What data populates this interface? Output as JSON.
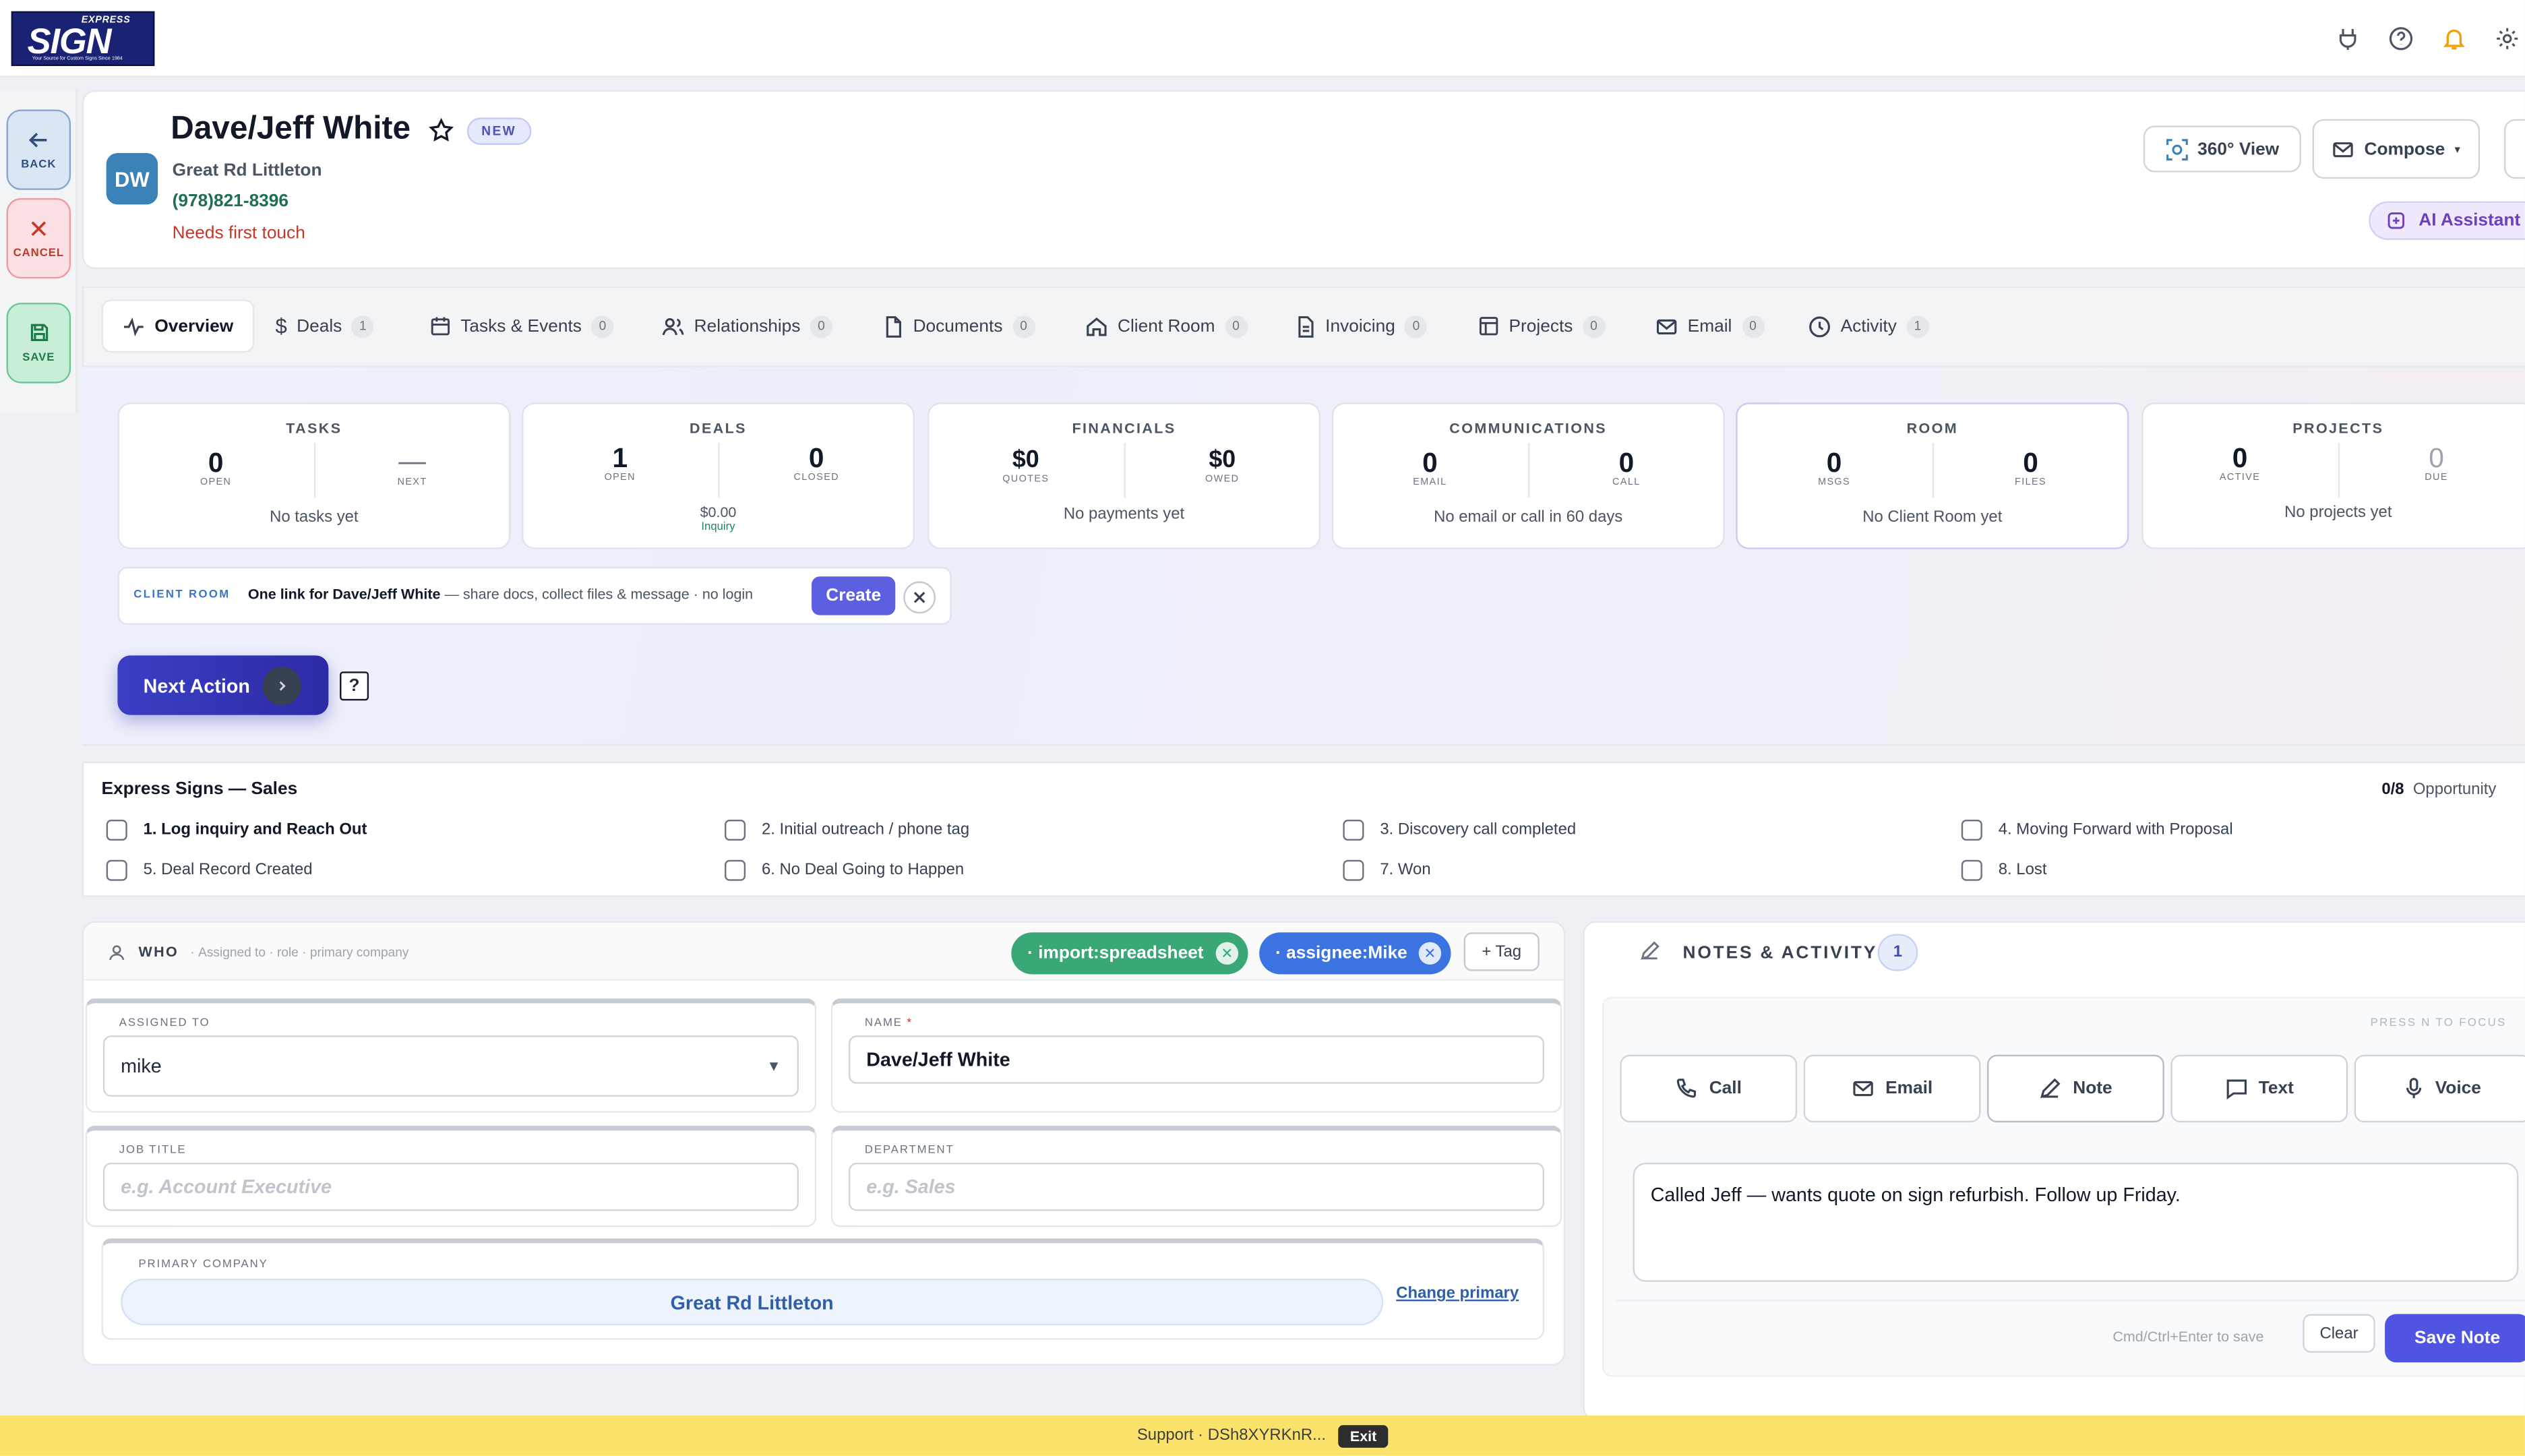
{
  "brand": {
    "logo_text": "SIGN",
    "logo_small": "EXPRESS",
    "logo_tagline": "Your Source for Custom Signs Since 1984"
  },
  "rail": {
    "back": "BACK",
    "cancel": "CANCEL",
    "save": "SAVE"
  },
  "contact": {
    "name": "Dave/Jeff White",
    "badge": "NEW",
    "initials": "DW",
    "address": "Great Rd Littleton",
    "phone": "(978)821-8396",
    "status": "Needs first touch"
  },
  "header_actions": {
    "view360": "360° View",
    "compose": "Compose",
    "ai": "AI Assistant"
  },
  "tabs": [
    {
      "label": "Overview"
    },
    {
      "label": "Deals",
      "count": "1"
    },
    {
      "label": "Tasks & Events",
      "count": "0"
    },
    {
      "label": "Relationships",
      "count": "0"
    },
    {
      "label": "Documents",
      "count": "0"
    },
    {
      "label": "Client Room",
      "count": "0"
    },
    {
      "label": "Invoicing",
      "count": "0"
    },
    {
      "label": "Projects",
      "count": "0"
    },
    {
      "label": "Email",
      "count": "0"
    },
    {
      "label": "Activity",
      "count": "1"
    }
  ],
  "stats": {
    "tasks": {
      "title": "TASKS",
      "a_val": "0",
      "a_lbl": "OPEN",
      "b_val": "—",
      "b_lbl": "NEXT",
      "foot": "No tasks yet"
    },
    "deals": {
      "title": "DEALS",
      "a_val": "1",
      "a_lbl": "OPEN",
      "b_val": "0",
      "b_lbl": "CLOSED",
      "foot": "$0.00",
      "foot2": "Inquiry"
    },
    "financials": {
      "title": "FINANCIALS",
      "a_val": "$0",
      "a_lbl": "QUOTES",
      "b_val": "$0",
      "b_lbl": "OWED",
      "foot": "No payments yet"
    },
    "communications": {
      "title": "COMMUNICATIONS",
      "a_val": "0",
      "a_lbl": "EMAIL",
      "b_val": "0",
      "b_lbl": "CALL",
      "foot": "No email or call in 60 days"
    },
    "room": {
      "title": "ROOM",
      "a_val": "0",
      "a_lbl": "MSGS",
      "b_val": "0",
      "b_lbl": "FILES",
      "foot": "No Client Room yet"
    },
    "projects": {
      "title": "PROJECTS",
      "a_val": "0",
      "a_lbl": "ACTIVE",
      "b_val": "0",
      "b_lbl": "DUE",
      "foot": "No projects yet"
    }
  },
  "client_room": {
    "tag": "CLIENT ROOM",
    "headline": "One link for Dave/Jeff White",
    "rest": " — share docs, collect files & message · no login",
    "create": "Create"
  },
  "next_action": {
    "label": "Next Action",
    "help": "?"
  },
  "pipeline": {
    "title": "Express Signs — Sales",
    "progress": "0/8",
    "kind": "Opportunity",
    "stages": [
      {
        "label": "1.  Log inquiry and Reach Out"
      },
      {
        "label": "2.  Initial outreach / phone tag"
      },
      {
        "label": "3.  Discovery call completed"
      },
      {
        "label": "4.  Moving Forward with Proposal"
      },
      {
        "label": "5.  Deal Record Created"
      },
      {
        "label": "6.  No Deal Going to Happen"
      },
      {
        "label": "7.  Won"
      },
      {
        "label": "8.  Lost"
      }
    ]
  },
  "who": {
    "title": "WHO",
    "subtitle": "Assigned to · role · primary company",
    "tags": [
      {
        "label": "· import:spreadsheet",
        "color": "#3aa876"
      },
      {
        "label": "· assignee:Mike",
        "color": "#3b74e0"
      }
    ],
    "add_tag": "+ Tag",
    "assigned_label": "ASSIGNED TO",
    "assigned_value": "mike",
    "name_label": "NAME",
    "name_req": "*",
    "name_value": "Dave/Jeff White",
    "job_label": "JOB TITLE",
    "job_placeholder": "e.g. Account Executive",
    "dept_label": "DEPARTMENT",
    "dept_placeholder": "e.g. Sales",
    "company_label": "PRIMARY COMPANY",
    "company_value": "Great Rd Littleton",
    "change_primary": "Change primary"
  },
  "notes": {
    "title": "NOTES & ACTIVITY",
    "count": "1",
    "hint": "PRESS N TO FOCUS",
    "actions": [
      {
        "label": "Call"
      },
      {
        "label": "Email"
      },
      {
        "label": "Note"
      },
      {
        "label": "Text"
      },
      {
        "label": "Voice"
      }
    ],
    "text": "Called Jeff — wants quote on sign refurbish. Follow up Friday.",
    "shortcut": "Cmd/Ctrl+Enter to save",
    "clear": "Clear",
    "save": "Save Note"
  },
  "support": {
    "text": "Support · DSh8XYRKnR...",
    "exit": "Exit"
  }
}
